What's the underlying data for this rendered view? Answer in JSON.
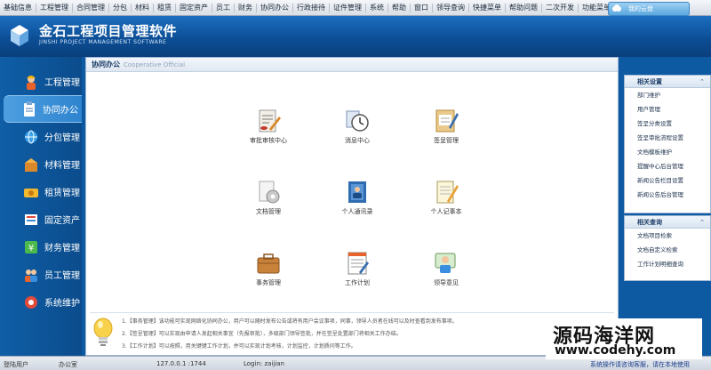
{
  "menubar": {
    "items": [
      "基础信息",
      "工程管理",
      "合同管理",
      "分包",
      "材料",
      "租赁",
      "固定资产",
      "员工",
      "财务",
      "协同办公",
      "行政接待",
      "证件管理",
      "系统",
      "帮助",
      "窗口",
      "领导查询",
      "快捷菜单",
      "帮助问题",
      "二次开发",
      "功能菜单单"
    ]
  },
  "cloud_button": {
    "label": "我的云盘"
  },
  "header": {
    "title": "金石工程项目管理软件",
    "subtitle": "JINSHI PROJECT MANAGEMENT SOFTWARE"
  },
  "sidebar": {
    "items": [
      {
        "label": "工程管理",
        "icon": "worker-icon",
        "active": false
      },
      {
        "label": "协同办公",
        "icon": "clipboard-icon",
        "active": true
      },
      {
        "label": "分包管理",
        "icon": "box-icon",
        "active": false
      },
      {
        "label": "材料管理",
        "icon": "material-icon",
        "active": false
      },
      {
        "label": "租赁管理",
        "icon": "lease-icon",
        "active": false
      },
      {
        "label": "固定资产",
        "icon": "asset-icon",
        "active": false
      },
      {
        "label": "财务管理",
        "icon": "finance-icon",
        "active": false
      },
      {
        "label": "员工管理",
        "icon": "staff-icon",
        "active": false
      },
      {
        "label": "系统维护",
        "icon": "settings-icon",
        "active": false
      }
    ]
  },
  "panel": {
    "title": "协同办公",
    "title_en": "Cooperative Official"
  },
  "apps": [
    {
      "label": "审批审核中心",
      "icon": "approval-icon"
    },
    {
      "label": "消息中心",
      "icon": "message-clock-icon"
    },
    {
      "label": "签呈管理",
      "icon": "sign-doc-icon"
    },
    {
      "label": "文档管理",
      "icon": "document-gear-icon"
    },
    {
      "label": "个人通讯录",
      "icon": "address-book-icon"
    },
    {
      "label": "个人记事本",
      "icon": "notebook-icon"
    },
    {
      "label": "事务管理",
      "icon": "briefcase-icon"
    },
    {
      "label": "工作计划",
      "icon": "work-plan-icon"
    },
    {
      "label": "领导意见",
      "icon": "leader-icon"
    }
  ],
  "tips": [
    "1.【事务管理】该功能可实现网络化协同办公，用户可以随时发布公告或将有用户会议事项，同事，领导人员者在线可以及时查看到发布事项。",
    "2.【签呈管理】可以实现由申请人发起相关事宜（先报审批），多级部门领导签批，并在签呈处置部门将相关工作办结。",
    "3.【工作计划】可以按照，用关键键工作计划，并可以实现计划考核，计划监控，计划质问等工作。"
  ],
  "right": {
    "section1": {
      "title": "相关设置",
      "links": [
        "部门维护",
        "用户管理",
        "签呈分类设置",
        "签呈审批流程设置",
        "文档模板维护",
        "提醒中心后台管理",
        "新闻公告栏目设置",
        "新闻公告后台管理"
      ]
    },
    "section2": {
      "title": "相关查询",
      "links": [
        "文档项目检索",
        "文档自定义检索",
        "工作计划明细查询"
      ]
    }
  },
  "status": {
    "user_label": "登陆用户",
    "user_value": "办公室",
    "ip": "127.0.0.1 :1744",
    "login": "Login: zaijian",
    "right_text": "系统操作请咨询客服，请在本地使用"
  },
  "watermark": {
    "cn": "源码海洋网",
    "url": "www.codehy.com"
  },
  "colors": {
    "header": "#0c4e96",
    "sidebar": "#0f5ea7",
    "active": "#4d9fe0"
  }
}
